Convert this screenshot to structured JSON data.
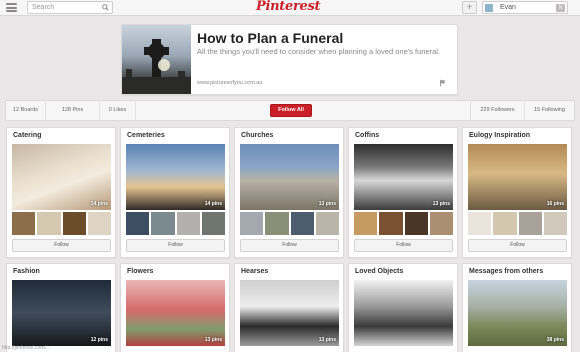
{
  "topbar": {
    "search_placeholder": "Search",
    "logo": "Pinterest",
    "add": "+",
    "user_name": "Evan",
    "user_badge": "N"
  },
  "board_header": {
    "title": "How to Plan a Funeral",
    "description": "All the things you'll need to consider when planning a loved one's funeral.",
    "link": "www.picturesofyou.com.au"
  },
  "stats": {
    "boards": "12 Boards",
    "pins": "128 Pins",
    "likes": "0 Likes",
    "follow_all": "Follow All",
    "followers": "229 Followers",
    "following": "15 Following"
  },
  "follow_label": "Follow",
  "boards": [
    {
      "title": "Catering",
      "pins": "14 pins",
      "cover": "linear-gradient(160deg,#c7b7a3 0%,#e9dfcf 40%,#f3ecdf 60%,#b69877 100%)",
      "thumbs": [
        "#8d6e4a",
        "#d5c8b0",
        "#6b4d2c",
        "#ddd4c6"
      ]
    },
    {
      "title": "Cemeteries",
      "pins": "14 pins",
      "cover": "linear-gradient(180deg,#5a82b3 0%,#9fb7d1 40%,#e4c38f 65%,#2f2a27 100%)",
      "thumbs": [
        "#3d4e63",
        "#7b8a8f",
        "#b2b0ad",
        "#6e746f"
      ]
    },
    {
      "title": "Churches",
      "pins": "13 pins",
      "cover": "linear-gradient(180deg,#6d8fba 0%,#8aa4c6 35%,#b9b2a6 55%,#7b7467 100%)",
      "thumbs": [
        "#a3a9af",
        "#8a8f78",
        "#4d5c6f",
        "#b9b5a9"
      ]
    },
    {
      "title": "Coffins",
      "pins": "13 pins",
      "cover": "linear-gradient(180deg,#2d2d2d 0%,#7a7a7a 35%,#d8d8d8 55%,#3c3c3c 100%)",
      "thumbs": [
        "#c69a63",
        "#7a5233",
        "#4b3524",
        "#aa8f72"
      ]
    },
    {
      "title": "Eulogy Inspiration",
      "pins": "16 pins",
      "cover": "linear-gradient(180deg,#b38a55 0%,#d8b985 45%,#6b5a44 100%)",
      "thumbs": [
        "#e8e4dc",
        "#d4c7b0",
        "#a8a29a",
        "#cfc8bb"
      ]
    },
    {
      "title": "Fashion",
      "pins": "12 pins",
      "cover": "linear-gradient(180deg,#1f2b38 0%,#3f4d5c 50%,#16181b 100%)",
      "thumbs": []
    },
    {
      "title": "Flowers",
      "pins": "13 pins",
      "cover": "linear-gradient(180deg,#e9b7b6 0%,#d76a6c 45%,#7e9c6d 75%,#b54040 100%)",
      "thumbs": []
    },
    {
      "title": "Hearses",
      "pins": "13 pins",
      "cover": "linear-gradient(180deg,#cfcfcf 0%,#ededed 40%,#2a2a2a 70%,#9c9c9c 100%)",
      "thumbs": []
    },
    {
      "title": "Loved Objects",
      "pins": "",
      "cover": "linear-gradient(180deg,#f2f2f2 0%,#9a9a9a 40%,#3a3a3a 70%,#d5d5d5 100%)",
      "thumbs": []
    },
    {
      "title": "Messages from others",
      "pins": "38 pins",
      "cover": "linear-gradient(180deg,#c7d4df 0%,#a6b0a6 40%,#7c8a5c 70%,#5d6a3e 100%)",
      "thumbs": []
    }
  ],
  "footer": "http://pinterest.com/..."
}
